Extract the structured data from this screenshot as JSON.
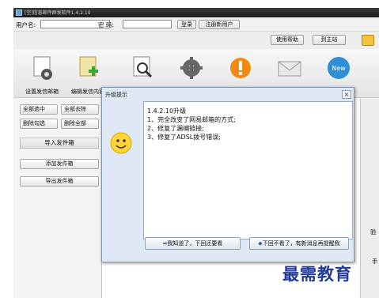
{
  "window": {
    "title": "[空]信息邮件群发软件1.4.2.10"
  },
  "login": {
    "username_label": "用户名:",
    "username_value": "",
    "password_label": "密 码:",
    "password_value": "",
    "login_button": "登录",
    "register_button": "注册新用户"
  },
  "top_links": {
    "help_button": "使用帮助",
    "home_button": "到主站"
  },
  "toolbar": [
    {
      "label": "设置发信邮箱",
      "icon": "gear-document-icon"
    },
    {
      "label": "编辑发信内容",
      "icon": "add-document-icon"
    },
    {
      "label": "",
      "icon": "search-document-icon"
    },
    {
      "label": "",
      "icon": "settings-gear-icon"
    },
    {
      "label": "",
      "icon": "warning-icon"
    },
    {
      "label": "",
      "icon": "mail-icon"
    },
    {
      "label": "",
      "icon": "news-icon"
    }
  ],
  "sidebar": {
    "select_all": "全部选中",
    "unselect_all": "全部去除",
    "delete_checked": "删除勾选",
    "delete_all": "删除全部",
    "import_section": "导入发件箱",
    "add_sender": "添加发件箱",
    "export_sender": "导出发件箱"
  },
  "dialog": {
    "title": "升级提示",
    "close": "×",
    "message": "1.4.2.10升级\n1、完全改变了网易邮箱的方式;\n2、修复了漏编链接;\n3、修复了ADSL拨号错误;",
    "button_ok": "我知道了，下回还要看",
    "button_never": "下回不看了，有新消息再提醒我"
  },
  "right_fragments": {
    "label_1": "验",
    "label_2": "手"
  },
  "watermark": "最需教育",
  "colors": {
    "dialog_bg": "#dfe9f5",
    "watermark": "#1f3a9a"
  }
}
